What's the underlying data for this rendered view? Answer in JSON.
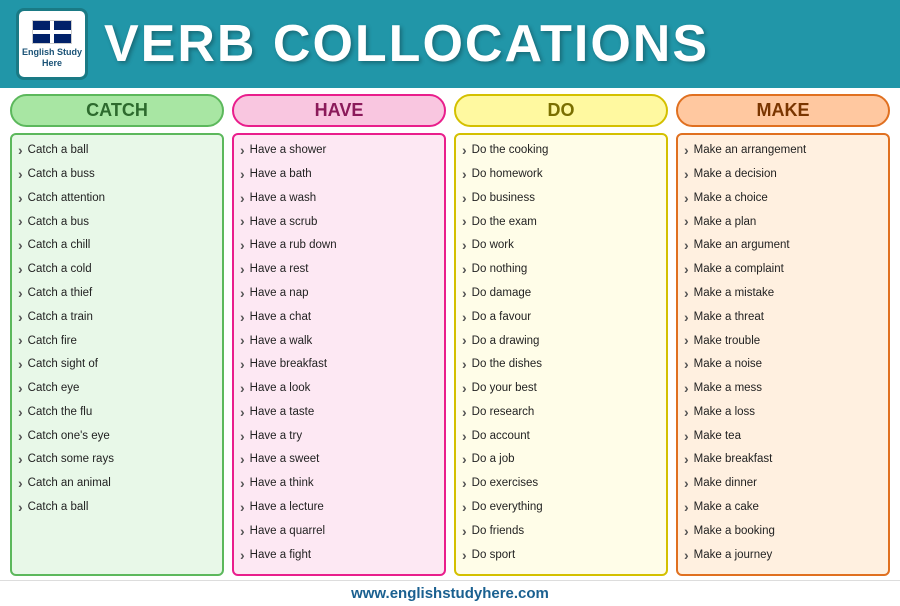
{
  "header": {
    "logo_line1": "English Study",
    "logo_line2": "Here",
    "title": "VERB COLLOCATIONS"
  },
  "columns": [
    {
      "id": "catch",
      "header": "CATCH",
      "items": [
        "Catch a ball",
        "Catch a buss",
        "Catch attention",
        "Catch a bus",
        "Catch a chill",
        "Catch a cold",
        "Catch a thief",
        "Catch a train",
        "Catch fire",
        "Catch sight of",
        "Catch eye",
        "Catch the flu",
        "Catch one's eye",
        "Catch some rays",
        "Catch an animal",
        "Catch a ball"
      ]
    },
    {
      "id": "have",
      "header": "HAVE",
      "items": [
        "Have a shower",
        "Have a bath",
        "Have a wash",
        "Have a scrub",
        "Have a rub down",
        "Have a rest",
        "Have a nap",
        "Have a chat",
        "Have a walk",
        "Have breakfast",
        "Have a look",
        "Have a taste",
        "Have a try",
        "Have a sweet",
        "Have a think",
        "Have a lecture",
        "Have a quarrel",
        "Have a fight"
      ]
    },
    {
      "id": "do",
      "header": "DO",
      "items": [
        "Do the cooking",
        "Do homework",
        "Do business",
        "Do the exam",
        "Do work",
        "Do nothing",
        "Do damage",
        "Do a favour",
        "Do a drawing",
        "Do the dishes",
        "Do your best",
        "Do research",
        "Do account",
        "Do a job",
        "Do exercises",
        "Do everything",
        "Do friends",
        "Do sport"
      ]
    },
    {
      "id": "make",
      "header": "MAKE",
      "items": [
        "Make an arrangement",
        "Make a decision",
        "Make a choice",
        "Make a plan",
        "Make an argument",
        "Make a complaint",
        "Make a mistake",
        "Make a threat",
        "Make trouble",
        "Make a noise",
        "Make a mess",
        "Make a loss",
        "Make tea",
        "Make breakfast",
        "Make dinner",
        "Make a cake",
        "Make a booking",
        "Make a journey"
      ]
    }
  ],
  "footer": {
    "url": "www.englishstudyhere.com"
  }
}
